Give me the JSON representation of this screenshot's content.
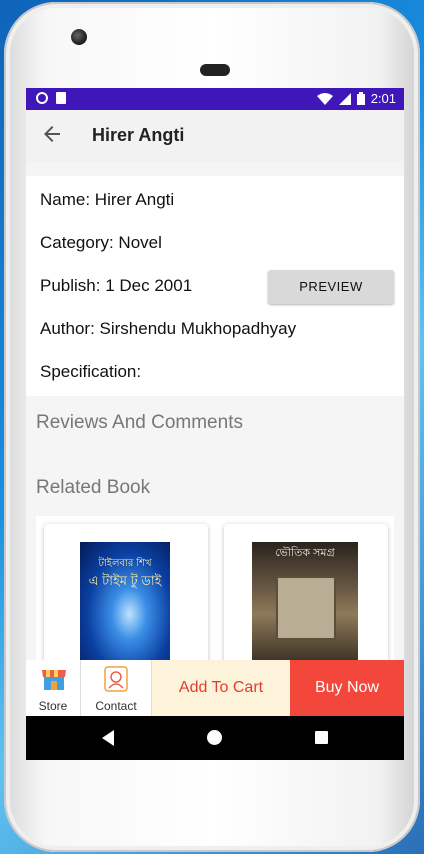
{
  "status_bar": {
    "time": "2:01"
  },
  "app_bar": {
    "title": "Hirer Angti"
  },
  "details": {
    "name": "Name: Hirer Angti",
    "category": "Category: Novel",
    "publish": "Publish: 1 Dec 2001",
    "author": "Author: Sirshendu Mukhopadhyay",
    "specification": "Specification:",
    "preview_label": "PREVIEW"
  },
  "sections": {
    "reviews_title": "Reviews And Comments",
    "related_title": "Related Book"
  },
  "related_books": [
    {
      "cover_top_text": "টাইলবার শিখ",
      "cover_title": "এ টাইম টু ডাই"
    },
    {
      "cover_title": "ভৌতিক সমগ্র"
    }
  ],
  "bottom_bar": {
    "store_label": "Store",
    "contact_label": "Contact",
    "add_to_cart_label": "Add To Cart",
    "buy_now_label": "Buy Now"
  },
  "colors": {
    "status_bar": "#3f16b8",
    "buy_now": "#f2473a",
    "add_to_cart_bg": "#fcf3da",
    "add_to_cart_text": "#e53b2e"
  }
}
